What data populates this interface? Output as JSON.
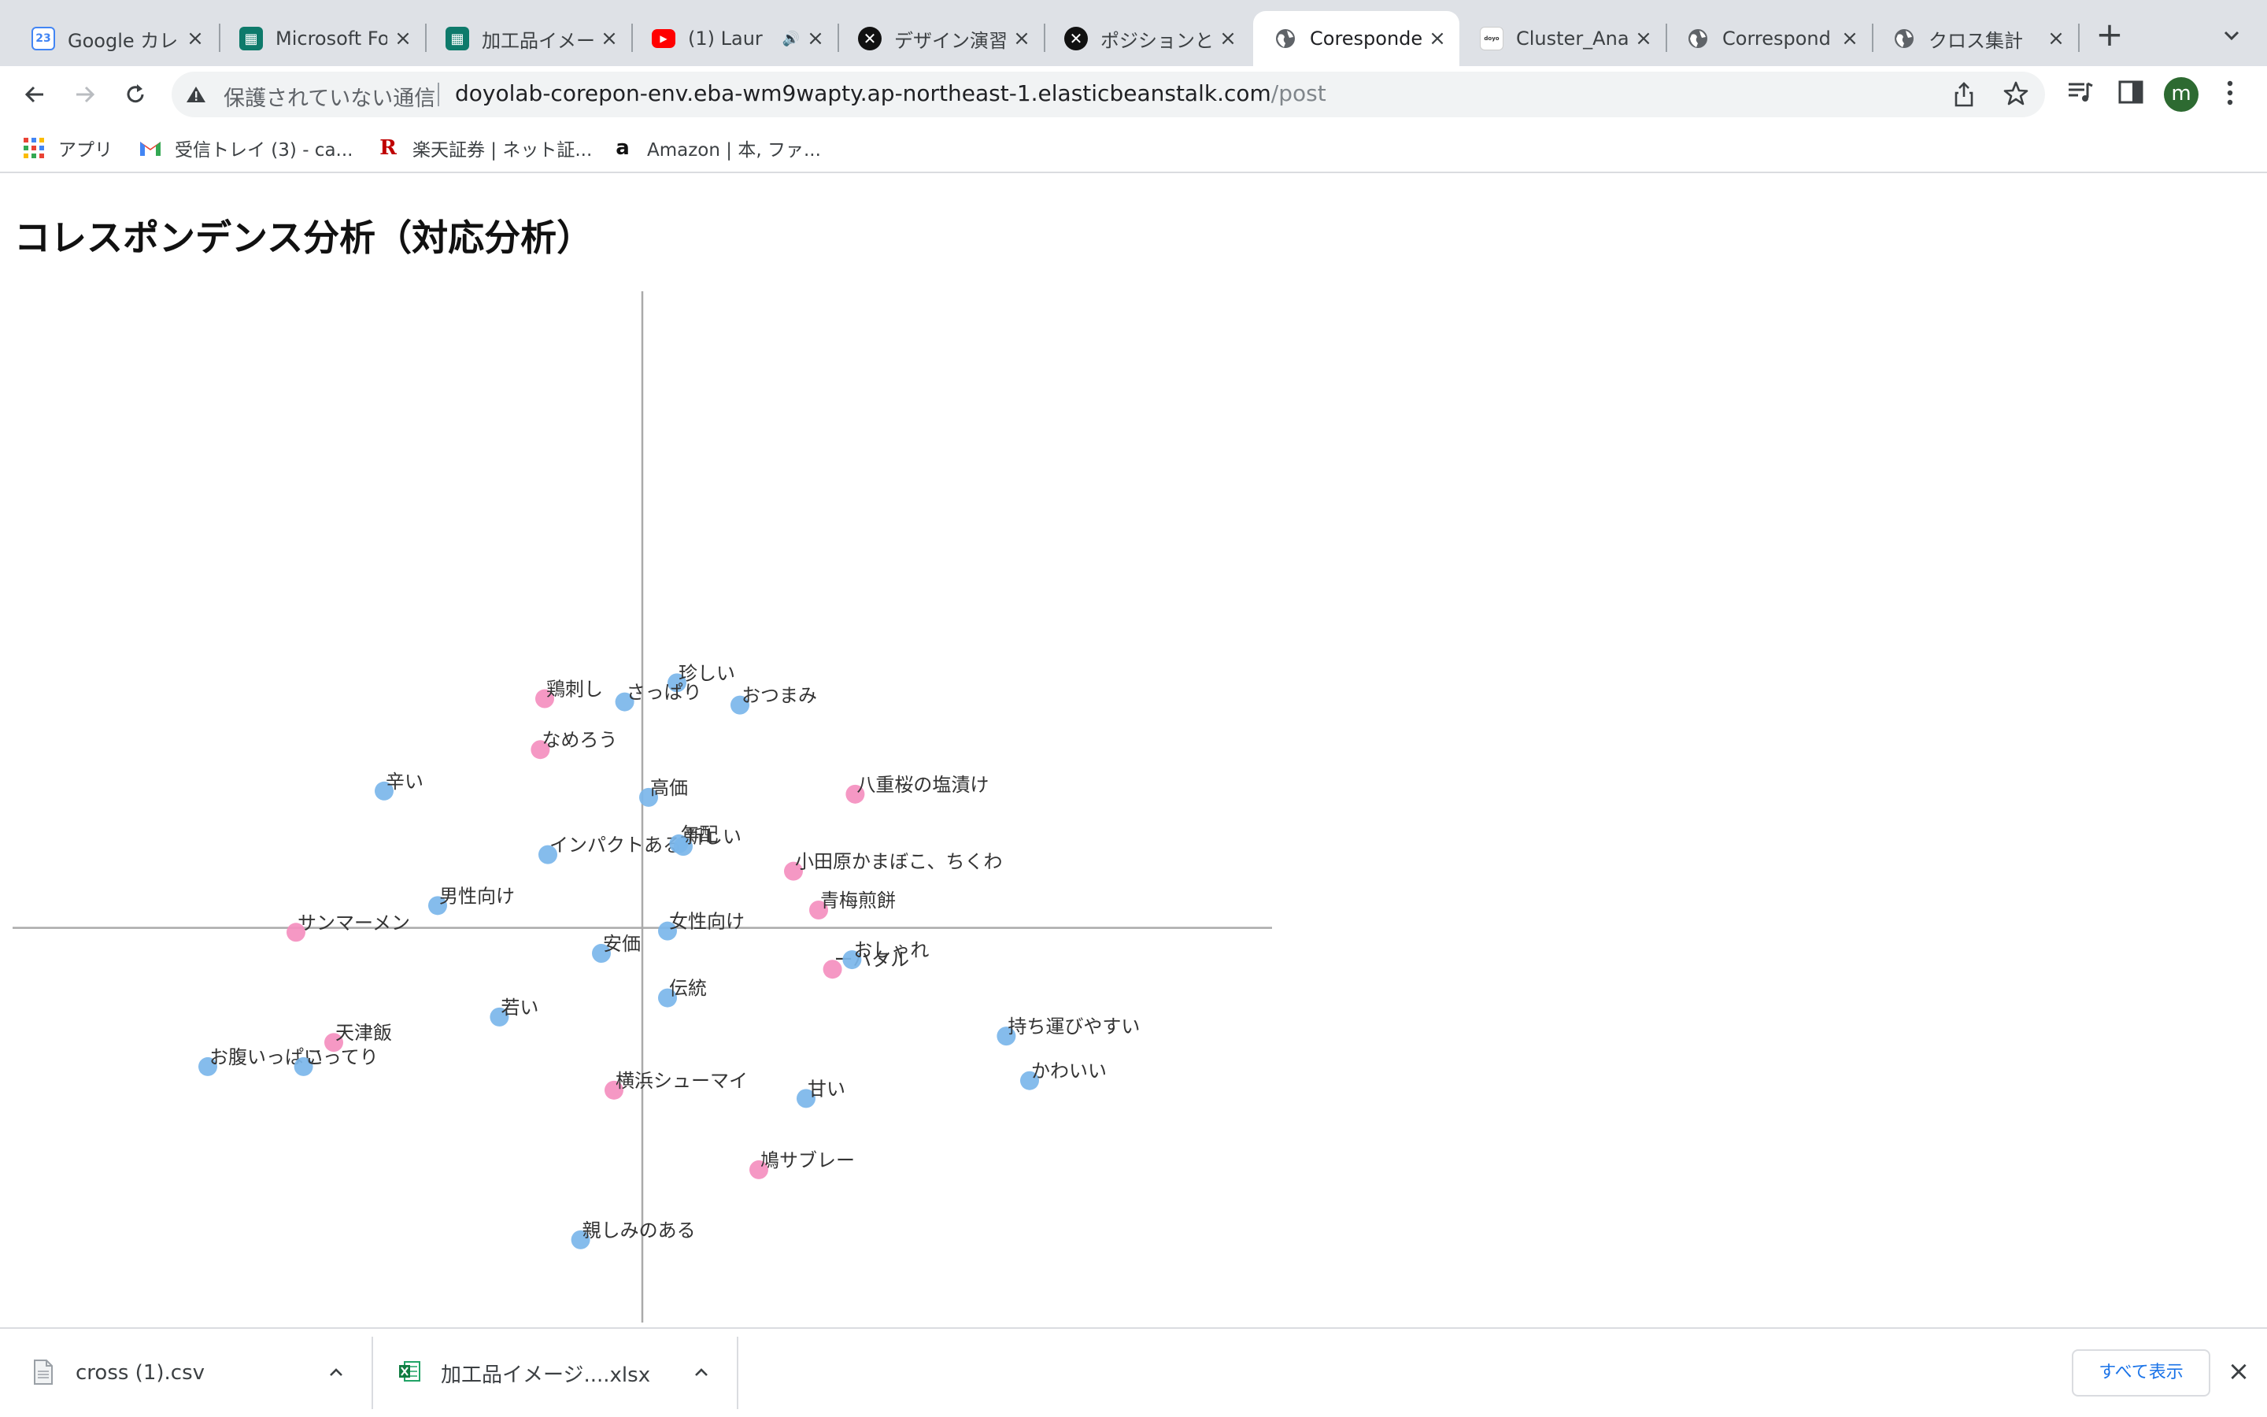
{
  "tabs": [
    {
      "title": "Google カレ",
      "favicon": "calendar-favicon",
      "active": false
    },
    {
      "title": "Microsoft Fo",
      "favicon": "forms-favicon",
      "active": false
    },
    {
      "title": "加工品イメー",
      "favicon": "forms-favicon",
      "active": false
    },
    {
      "title": "(1) Laur",
      "favicon": "youtube-favicon",
      "active": false,
      "audio": true
    },
    {
      "title": "デザイン演習",
      "favicon": "x-favicon",
      "active": false
    },
    {
      "title": "ポジションと",
      "favicon": "x-favicon",
      "active": false
    },
    {
      "title": "Corespondence",
      "favicon": "globe-favicon",
      "active": true
    },
    {
      "title": "Cluster_Ana",
      "favicon": "doyolab-favicon",
      "active": false
    },
    {
      "title": "Correspond",
      "favicon": "globe-favicon",
      "active": false
    },
    {
      "title": "クロス集計",
      "favicon": "globe-favicon",
      "active": false
    }
  ],
  "toolbar": {
    "security_label": "保護されていない通信",
    "url_host": "doyolab-corepon-env.eba-wm9wapty.ap-northeast-1.elasticbeanstalk.com",
    "url_path": "/post",
    "avatar_initial": "m"
  },
  "bookmarks": [
    {
      "label": "アプリ",
      "icon": "apps-grid-icon"
    },
    {
      "label": "受信トレイ (3) - ca...",
      "icon": "gmail-icon"
    },
    {
      "label": "楽天証券 | ネット証...",
      "icon": "rakuten-icon"
    },
    {
      "label": "Amazon | 本, ファ...",
      "icon": "amazon-icon"
    }
  ],
  "page": {
    "title": "コレスポンデンス分析（対応分析）"
  },
  "chart_data": {
    "type": "scatter",
    "title": "",
    "xlabel": "",
    "ylabel": "",
    "xlim": [
      -1.0,
      1.0
    ],
    "ylim": [
      -0.62,
      1.0
    ],
    "grid": false,
    "colors": {
      "row": "#f48fbf",
      "column": "#7bb6ea",
      "axis": "#aaaaaa"
    },
    "series": [
      {
        "group": "row",
        "points": [
          {
            "label": "鶏刺し",
            "x": -0.155,
            "y": 0.36
          },
          {
            "label": "なめろう",
            "x": -0.162,
            "y": 0.28
          },
          {
            "label": "八重桜の塩漬け",
            "x": 0.338,
            "y": 0.21
          },
          {
            "label": "小田原かまぼこ、ちくわ",
            "x": 0.24,
            "y": 0.089
          },
          {
            "label": "青梅煎餅",
            "x": 0.28,
            "y": 0.028
          },
          {
            "label": "サンマーメン",
            "x": -0.55,
            "y": -0.007
          },
          {
            "label": "ーハタル",
            "x": 0.302,
            "y": -0.065
          },
          {
            "label": "天津飯",
            "x": -0.49,
            "y": -0.18
          },
          {
            "label": "横浜シューマイ",
            "x": -0.045,
            "y": -0.255
          },
          {
            "label": "鳩サブレー",
            "x": 0.185,
            "y": -0.38
          }
        ]
      },
      {
        "group": "column",
        "points": [
          {
            "label": "珍しい",
            "x": 0.055,
            "y": 0.385
          },
          {
            "label": "さっぱり",
            "x": -0.028,
            "y": 0.355
          },
          {
            "label": "おつまみ",
            "x": 0.155,
            "y": 0.35
          },
          {
            "label": "辛い",
            "x": -0.41,
            "y": 0.215
          },
          {
            "label": "高価",
            "x": 0.01,
            "y": 0.205
          },
          {
            "label": "インパクトある",
            "x": -0.15,
            "y": 0.115
          },
          {
            "label": "年配",
            "x": 0.058,
            "y": 0.132
          },
          {
            "label": "新しい",
            "x": 0.065,
            "y": 0.128
          },
          {
            "label": "男性向け",
            "x": -0.325,
            "y": 0.035
          },
          {
            "label": "女性向け",
            "x": 0.04,
            "y": -0.005
          },
          {
            "label": "安価",
            "x": -0.065,
            "y": -0.04
          },
          {
            "label": "おしゃれ",
            "x": 0.333,
            "y": -0.05
          },
          {
            "label": "伝統",
            "x": 0.04,
            "y": -0.11
          },
          {
            "label": "若い",
            "x": -0.227,
            "y": -0.14
          },
          {
            "label": "お腹いっぱい",
            "x": -0.69,
            "y": -0.218
          },
          {
            "label": "こってり",
            "x": -0.538,
            "y": -0.218
          },
          {
            "label": "持ち運びやすい",
            "x": 0.578,
            "y": -0.17
          },
          {
            "label": "かわいい",
            "x": 0.615,
            "y": -0.24
          },
          {
            "label": "甘い",
            "x": 0.26,
            "y": -0.268
          },
          {
            "label": "親しみのある",
            "x": -0.098,
            "y": -0.49
          }
        ]
      }
    ]
  },
  "downloads": [
    {
      "filename": "cross (1).csv",
      "icon": "csv-file-icon"
    },
    {
      "filename": "加工品イメージ....xlsx",
      "icon": "excel-file-icon"
    }
  ],
  "download_shelf": {
    "show_all_label": "すべて表示"
  }
}
